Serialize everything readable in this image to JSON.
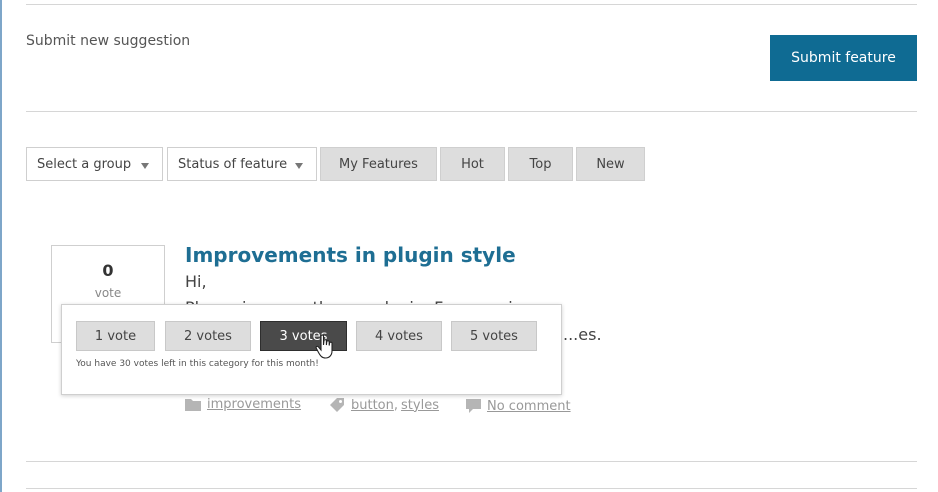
{
  "header": {
    "submit_label": "Submit new suggestion",
    "submit_button": "Submit feature"
  },
  "filters": {
    "group_select": "Select a group",
    "status_select": "Status of feature",
    "tabs": [
      "My Features",
      "Hot",
      "Top",
      "New"
    ]
  },
  "feature": {
    "votes": "0",
    "vote_word": "vote",
    "title": "Improvements in plugin style",
    "description": [
      "Hi,",
      "Please improve the... ...plugin. Fe... ...ugin.",
      "...es."
    ],
    "category": "improvements",
    "tags": [
      "button",
      "styles"
    ],
    "comments": "No comment"
  },
  "vote_popup": {
    "options": [
      "1 vote",
      "2 votes",
      "3 votes",
      "4 votes",
      "5 votes"
    ],
    "selected": 2,
    "note": "You have 30 votes left in this category for this month!"
  },
  "colors": {
    "accent": "#0f6b93",
    "title": "#1e6e93",
    "selected_option": "#4a4a4a"
  }
}
